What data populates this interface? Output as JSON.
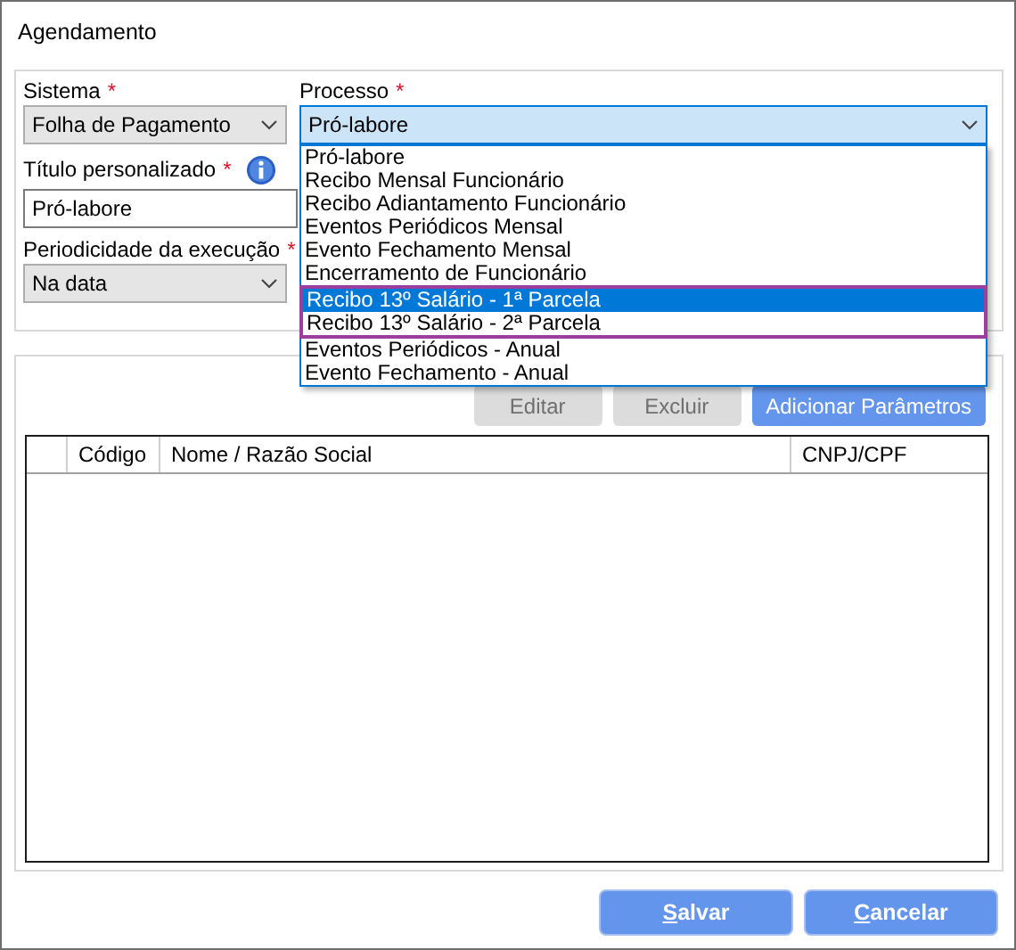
{
  "window": {
    "title": "Agendamento"
  },
  "fields": {
    "sistema": {
      "label": "Sistema",
      "required_mark": "*",
      "value": "Folha de Pagamento"
    },
    "processo": {
      "label": "Processo",
      "required_mark": "*",
      "value": "Pró-labore",
      "expanded": true
    },
    "titulo": {
      "label": "Título personalizado",
      "required_mark": "*",
      "value": "Pró-labore"
    },
    "periodicidade": {
      "label": "Periodicidade da execução",
      "required_mark": "*",
      "value": "Na data"
    }
  },
  "processo_options": [
    {
      "label": "Pró-labore",
      "selected": false,
      "highlighted": false
    },
    {
      "label": "Recibo Mensal Funcionário",
      "selected": false,
      "highlighted": false
    },
    {
      "label": "Recibo Adiantamento Funcionário",
      "selected": false,
      "highlighted": false
    },
    {
      "label": "Eventos Periódicos Mensal",
      "selected": false,
      "highlighted": false
    },
    {
      "label": "Evento Fechamento Mensal",
      "selected": false,
      "highlighted": false
    },
    {
      "label": "Encerramento de Funcionário",
      "selected": false,
      "highlighted": false
    },
    {
      "label": "Recibo 13º Salário - 1ª Parcela",
      "selected": true,
      "highlighted": true
    },
    {
      "label": "Recibo 13º Salário - 2ª Parcela",
      "selected": false,
      "highlighted": true
    },
    {
      "label": "Eventos Periódicos - Anual",
      "selected": false,
      "highlighted": false
    },
    {
      "label": "Evento Fechamento - Anual",
      "selected": false,
      "highlighted": false
    }
  ],
  "parameter_buttons": [
    {
      "label": "Editar",
      "disabled": true
    },
    {
      "label": "Excluir",
      "disabled": true
    },
    {
      "label": "Adicionar Parâmetros",
      "disabled": false
    }
  ],
  "table": {
    "columns": [
      "Código",
      "Nome / Razão Social",
      "CNPJ/CPF"
    ]
  },
  "footer_buttons": [
    {
      "key": "S",
      "rest": "alvar"
    },
    {
      "key": "C",
      "rest": "ancelar"
    }
  ]
}
